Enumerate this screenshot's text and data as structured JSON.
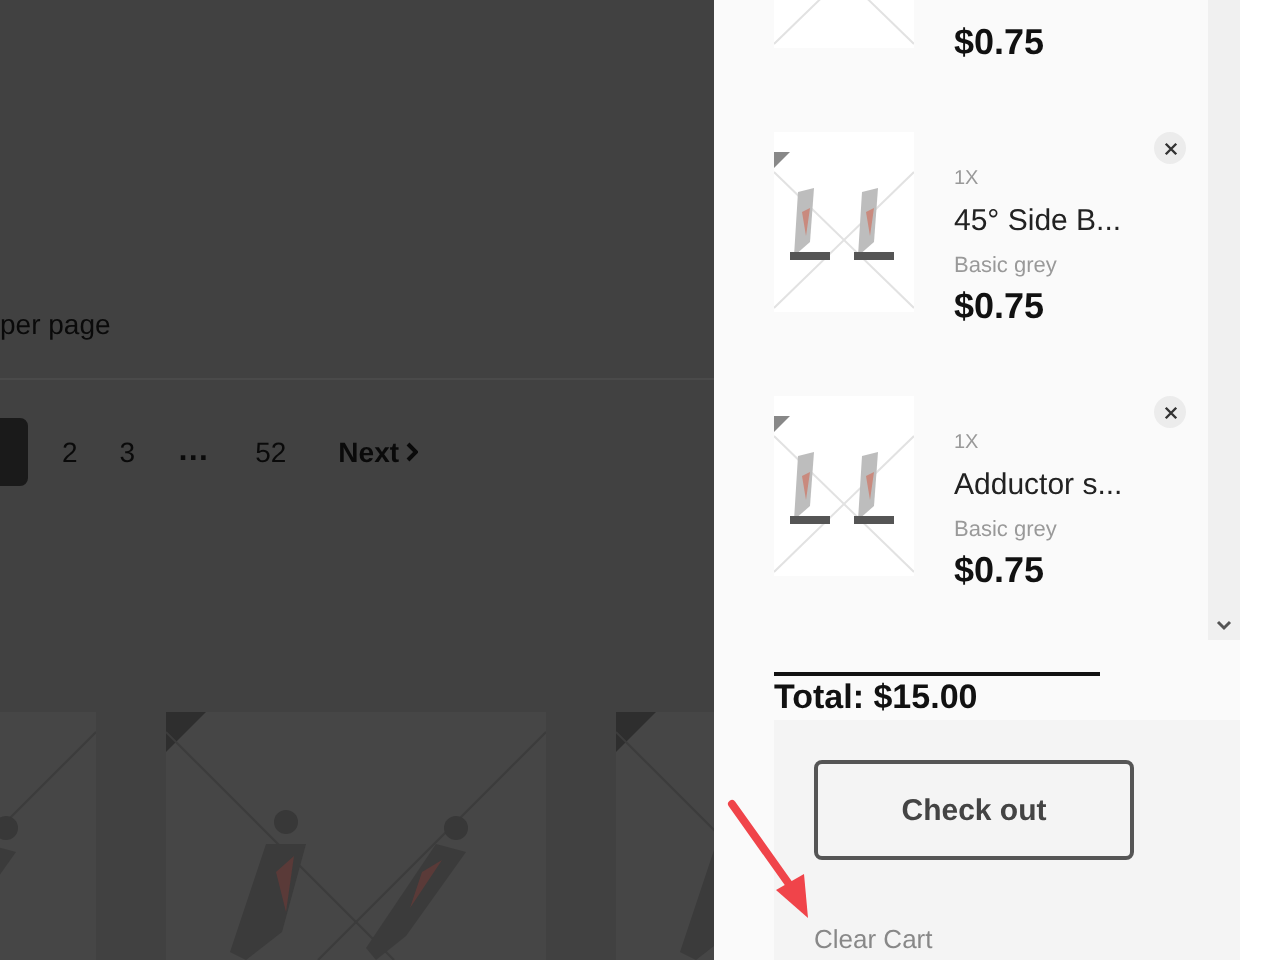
{
  "shop": {
    "per_page_label": "per page",
    "pagination": [
      {
        "kind": "current",
        "selected": true
      },
      {
        "kind": "page",
        "label": "2",
        "selected": false
      },
      {
        "kind": "page",
        "label": "3",
        "selected": false
      },
      {
        "kind": "ellipsis",
        "label": "…"
      },
      {
        "kind": "page",
        "label": "52",
        "selected": false
      }
    ],
    "next_label": "Next"
  },
  "cart": {
    "items": [
      {
        "price": "$0.75"
      },
      {
        "quantity": "1X",
        "title": "45° Side B...",
        "variant": "Basic grey",
        "price": "$0.75"
      },
      {
        "quantity": "1X",
        "title": "Adductor s...",
        "variant": "Basic grey",
        "price": "$0.75"
      }
    ],
    "total": "Total: $15.00",
    "checkout_label": "Check out",
    "clear_label": "Clear Cart"
  },
  "annotation": {
    "kind": "arrow"
  }
}
